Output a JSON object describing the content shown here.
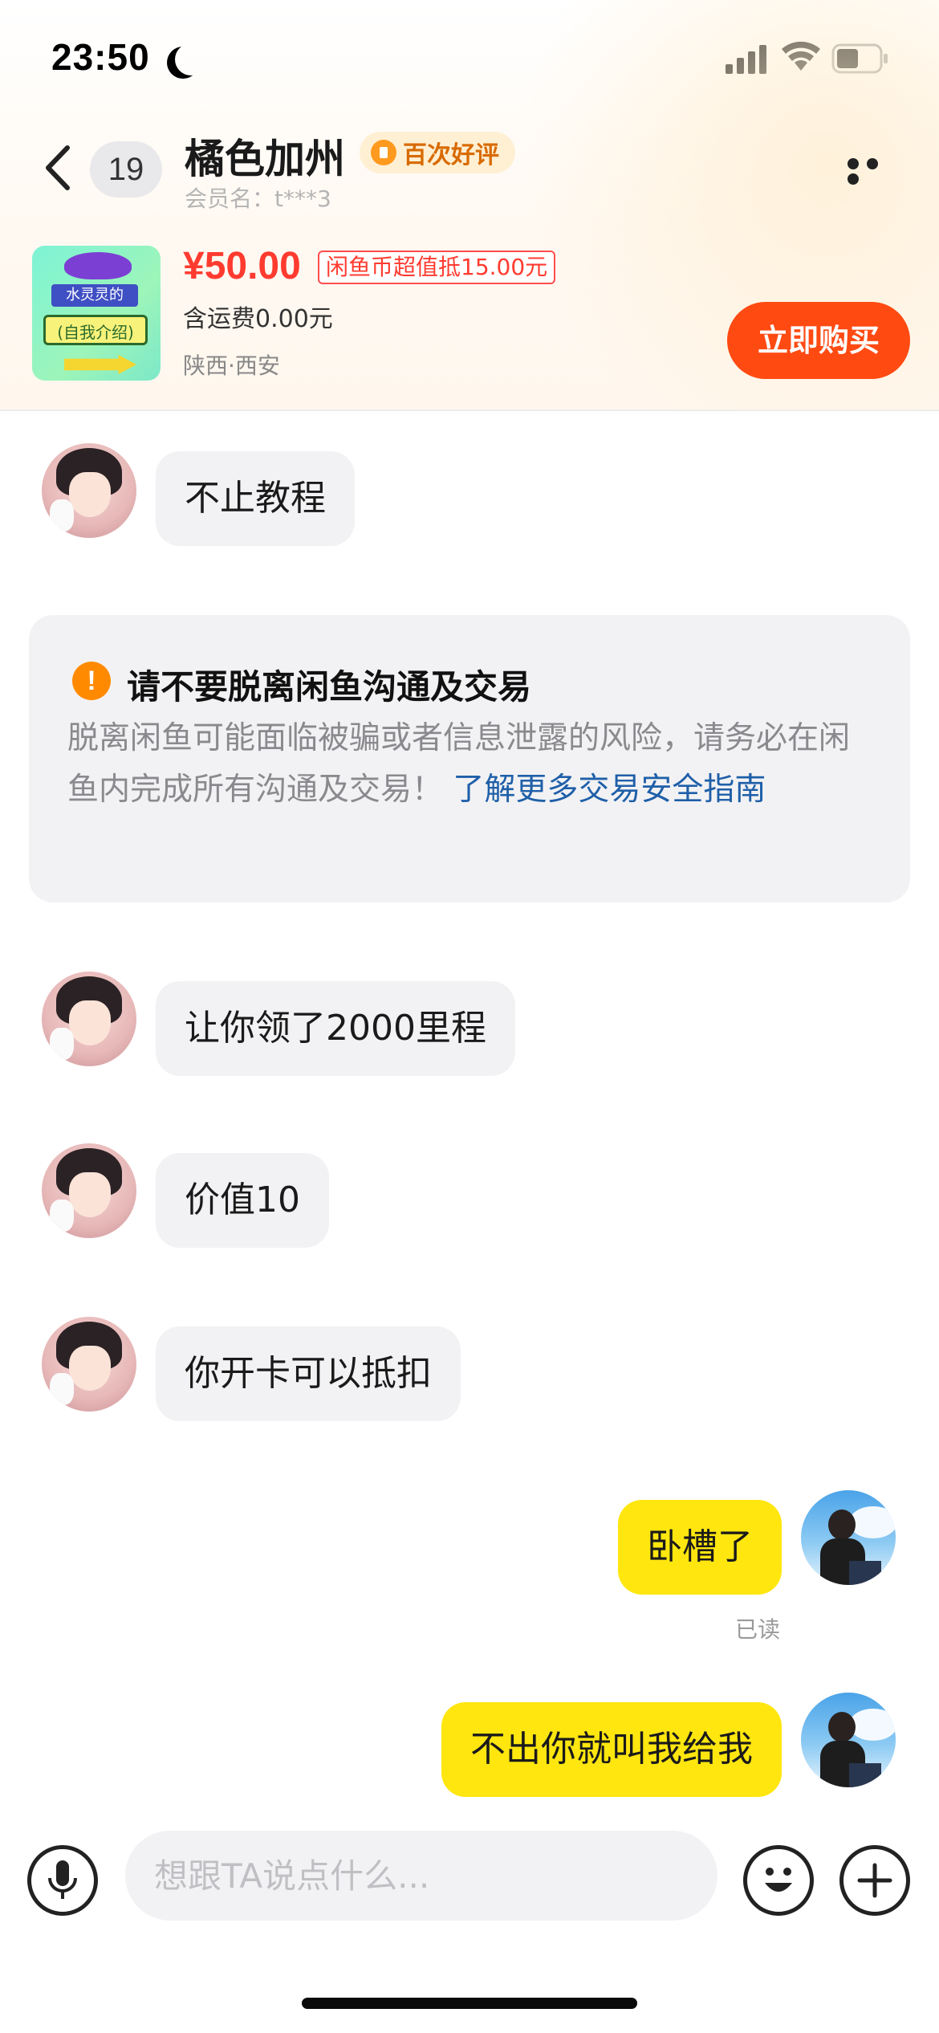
{
  "status_bar": {
    "time": "23:50"
  },
  "header": {
    "unread_count": "19",
    "title": "橘色加州",
    "badge": "百次好评",
    "member_name": "会员名：t***3"
  },
  "product": {
    "price": "¥50.00",
    "coin_deduction": "闲鱼币超值抵15.00元",
    "shipping": "含运费0.00元",
    "location": "陕西·西安",
    "buy_label": "立即购买",
    "image_text_1": "水灵灵的",
    "image_text_2": "(自我介绍)"
  },
  "messages": {
    "m1": "不止教程",
    "m2": "让你领了2000里程",
    "m3": "价值10",
    "m4": "你开卡可以抵扣",
    "m5": "卧槽了",
    "m5_status": "已读",
    "m6": "不出你就叫我给我"
  },
  "safety_notice": {
    "title": "请不要脱离闲鱼沟通及交易",
    "body": "脱离闲鱼可能面临被骗或者信息泄露的风险，请务必在闲鱼内完成所有沟通及交易！",
    "link": "了解更多交易安全指南"
  },
  "input": {
    "placeholder": "想跟TA说点什么..."
  },
  "colors": {
    "accent": "#ff4a12",
    "price": "#ff3b30",
    "outgoing_bubble": "#ffe60f",
    "incoming_bubble": "#f2f2f4",
    "link": "#1f5fa8"
  },
  "icons": [
    "moon-icon",
    "signal-icon",
    "wifi-icon",
    "battery-icon",
    "back-icon",
    "more-icon",
    "warning-icon",
    "microphone-icon",
    "emoji-icon",
    "plus-icon"
  ]
}
